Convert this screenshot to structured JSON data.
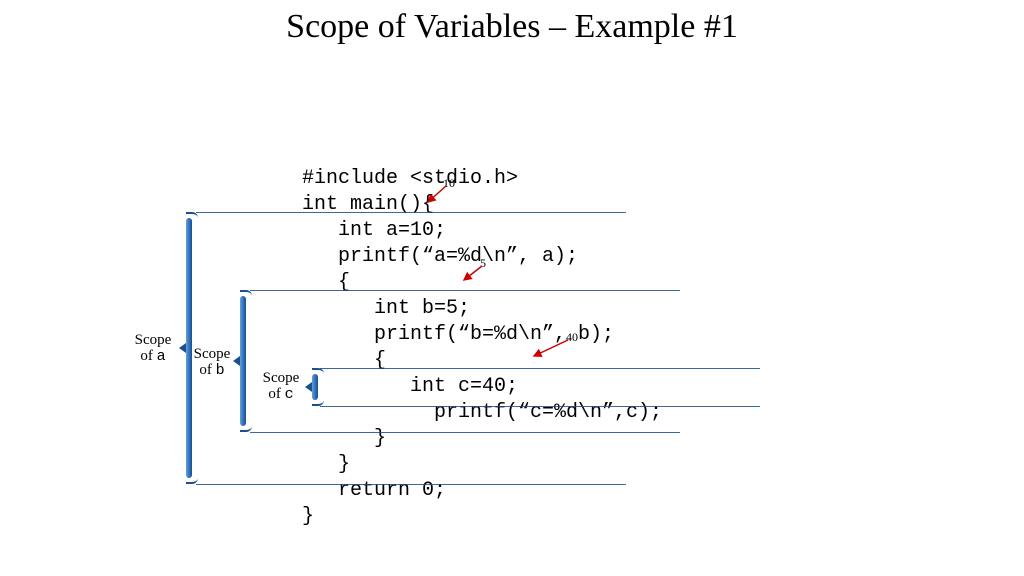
{
  "title": "Scope of Variables – Example #1",
  "code": {
    "l1": "#include <stdio.h>",
    "l2": "int main(){",
    "l3": "   int a=10;",
    "l4": "   printf(“a=%d\\n”, a);",
    "l5": "   {",
    "l6": "      int b=5;",
    "l7": "      printf(“b=%d\\n”, b);",
    "l8": "      {",
    "l9": "         int c=40;",
    "l10": "           printf(“c=%d\\n”,c);",
    "l11": "      }",
    "l12": "   }",
    "l13": "   return 0;",
    "l14": "}"
  },
  "scopes": {
    "a": {
      "label_top": "Scope",
      "label_bot_pre": "of ",
      "var": "a"
    },
    "b": {
      "label_top": "Scope",
      "label_bot_pre": "of ",
      "var": "b"
    },
    "c": {
      "label_top": "Scope",
      "label_bot_pre": "of ",
      "var": "c"
    }
  },
  "annotations": {
    "a": "10",
    "b": "5",
    "c": "40"
  },
  "colors": {
    "rule": "#1c4e8a",
    "brace_light": "#6a9fd6",
    "brace_dark": "#1d4f8d",
    "arrow": "#cc0000"
  }
}
